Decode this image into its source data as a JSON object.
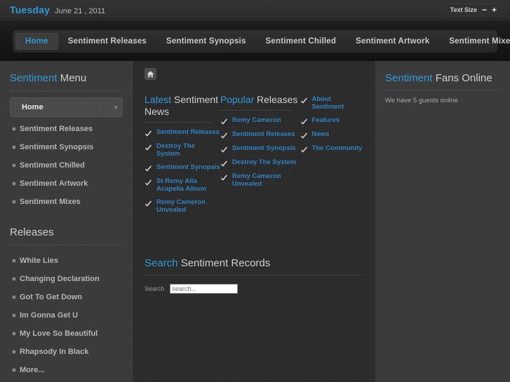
{
  "topbar": {
    "day": "Tuesday",
    "date": "June 21 , 2011",
    "textsize_label": "Text Size",
    "decrease": "−",
    "increase": "+"
  },
  "nav": {
    "items": [
      {
        "label": "Home",
        "active": true
      },
      {
        "label": "Sentiment Releases",
        "active": false
      },
      {
        "label": "Sentiment Synopsis",
        "active": false
      },
      {
        "label": "Sentiment Chilled",
        "active": false
      },
      {
        "label": "Sentiment Artwork",
        "active": false
      },
      {
        "label": "Sentiment Mixes",
        "active": false
      }
    ]
  },
  "sidebar": {
    "menu_title_hl": "Sentiment",
    "menu_title_rest": " Menu",
    "items": [
      {
        "label": "Home",
        "active": true
      },
      {
        "label": "Sentiment Releases",
        "active": false
      },
      {
        "label": "Sentiment Synopsis",
        "active": false
      },
      {
        "label": "Sentiment Chilled",
        "active": false
      },
      {
        "label": "Sentiment Artwork",
        "active": false
      },
      {
        "label": "Sentiment Mixes",
        "active": false
      }
    ],
    "releases_title": "Releases",
    "releases": [
      {
        "label": "White Lies"
      },
      {
        "label": "Changing Declaration"
      },
      {
        "label": "Got To Get Down"
      },
      {
        "label": "Im Gonna Get U"
      },
      {
        "label": "My Love So Beautiful"
      },
      {
        "label": "Rhapsody In Black"
      },
      {
        "label": "More..."
      }
    ]
  },
  "main": {
    "breadcrumb_icon": "home-icon",
    "modules": [
      {
        "title_hl": "Latest",
        "title_rest": " Sentiment News",
        "items": [
          "Sentiment Releases",
          "Destroy The System",
          "Sentiment Synopsis",
          "St Remy Alla Acapella Album",
          "Remy Cameron Unvealed"
        ]
      },
      {
        "title_hl": "Popular",
        "title_rest": " Releases",
        "items": [
          "Remy Cameron",
          "Sentiment Releases",
          "Sentiment Synopsis",
          "Destroy The System",
          "Remy Cameron Unvealed"
        ]
      },
      {
        "title_hl": "",
        "title_rest": "",
        "items": [
          "About Sentiment",
          "Features",
          "News",
          "The Community"
        ]
      }
    ],
    "search": {
      "title_hl": "Search",
      "title_rest": " Sentiment Records",
      "label": "Search",
      "placeholder": "search...",
      "value": ""
    }
  },
  "right": {
    "title_hl": "Sentiment",
    "title_rest": " Fans Online",
    "guests": "We have 5 guests online"
  },
  "colors": {
    "accent": "#2f9ada",
    "link": "#2f83c4",
    "page_bg": "#3b3b3b",
    "main_bg": "#2b2b2b",
    "nav_bg": "#161616"
  }
}
